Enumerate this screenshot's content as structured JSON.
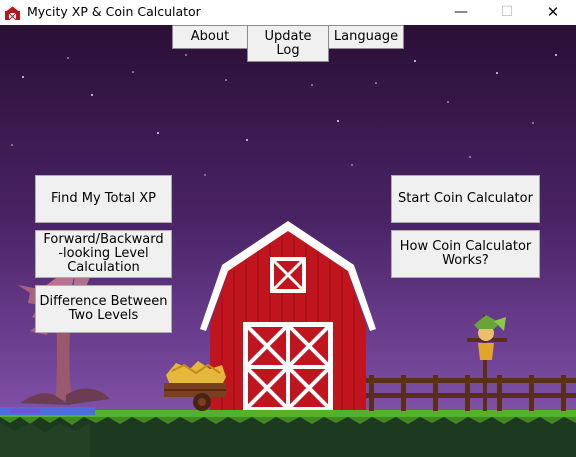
{
  "window": {
    "title": "Mycity XP & Coin Calculator",
    "minimize_glyph": "—",
    "maximize_glyph": "☐",
    "close_glyph": "✕"
  },
  "menu": {
    "about": "About",
    "update_log_line1": "Update",
    "update_log_line2": "Log",
    "language": "Language"
  },
  "left_buttons": {
    "total_xp": "Find My Total XP",
    "forward_backward_line1": "Forward/Backward",
    "forward_backward_line2": "-looking Level",
    "forward_backward_line3": "Calculation",
    "difference_line1": "Difference Between",
    "difference_line2": "Two Levels"
  },
  "right_buttons": {
    "start_coin": "Start Coin Calculator",
    "how_coin_line1": "How Coin Calculator",
    "how_coin_line2": "Works?"
  },
  "colors": {
    "sky_top": "#2a0f35",
    "sky_bottom": "#7a4a9e",
    "barn_red": "#c0141e",
    "grass": "#55b02c"
  }
}
